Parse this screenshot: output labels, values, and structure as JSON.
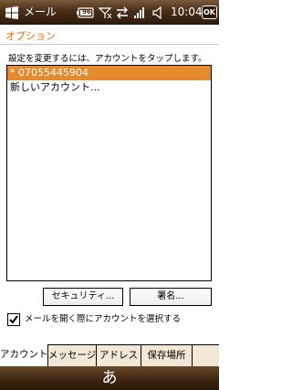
{
  "statusbar": {
    "app_title": "メール",
    "battery_label": "96",
    "time": "10:04",
    "ok_label": "OK",
    "icons": [
      "windows-start-icon",
      "battery-icon",
      "signal-icon",
      "sync-arrows-icon",
      "signal-bars-icon",
      "volume-icon"
    ]
  },
  "page": {
    "title": "オプション",
    "instruction": "設定を変更するには、アカウントをタップします。"
  },
  "accounts": {
    "items": [
      {
        "label": "* 07055445904",
        "selected": true
      },
      {
        "label": "新しいアカウント...",
        "selected": false
      }
    ]
  },
  "buttons": {
    "security": "セキュリティ...",
    "signature": "署名..."
  },
  "checkbox": {
    "label": "メールを開く際にアカウントを選択する",
    "checked": true
  },
  "tabs": [
    {
      "label": "アカウント",
      "active": true
    },
    {
      "label": "メッセージ",
      "active": false
    },
    {
      "label": "アドレス",
      "active": false
    },
    {
      "label": "保存場所",
      "active": false
    }
  ],
  "softkeys": {
    "ime_label": "あ"
  },
  "colors": {
    "accent": "#e68a2e",
    "title_text": "#e06a00",
    "bar_dark": "#2f1c0b"
  }
}
